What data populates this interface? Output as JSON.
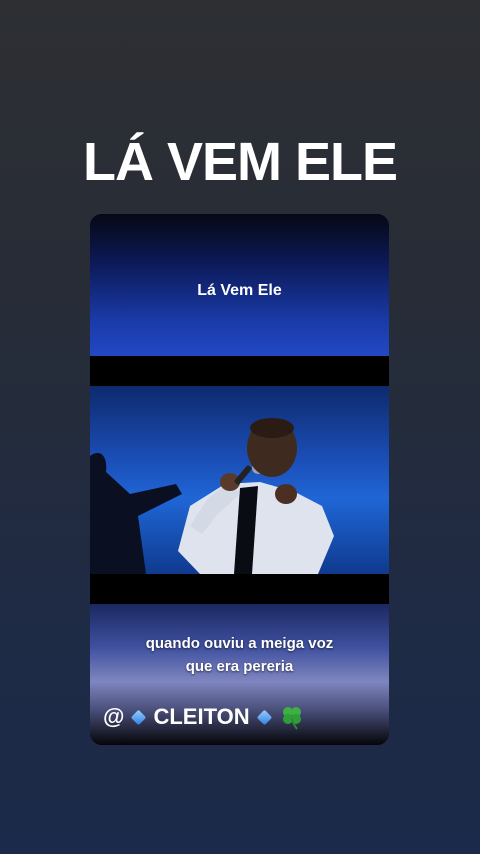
{
  "headline": "LÁ VEM ELE",
  "video_card": {
    "top_caption": "Lá Vem  Ele",
    "subtitle_line1": "quando ouviu a meiga voz",
    "subtitle_line2": "que era pereria",
    "signature_prefix": "@",
    "signature_name": "CLEITON"
  },
  "icons": [
    "small-blue-diamond-icon",
    "four-leaf-clover-icon"
  ]
}
